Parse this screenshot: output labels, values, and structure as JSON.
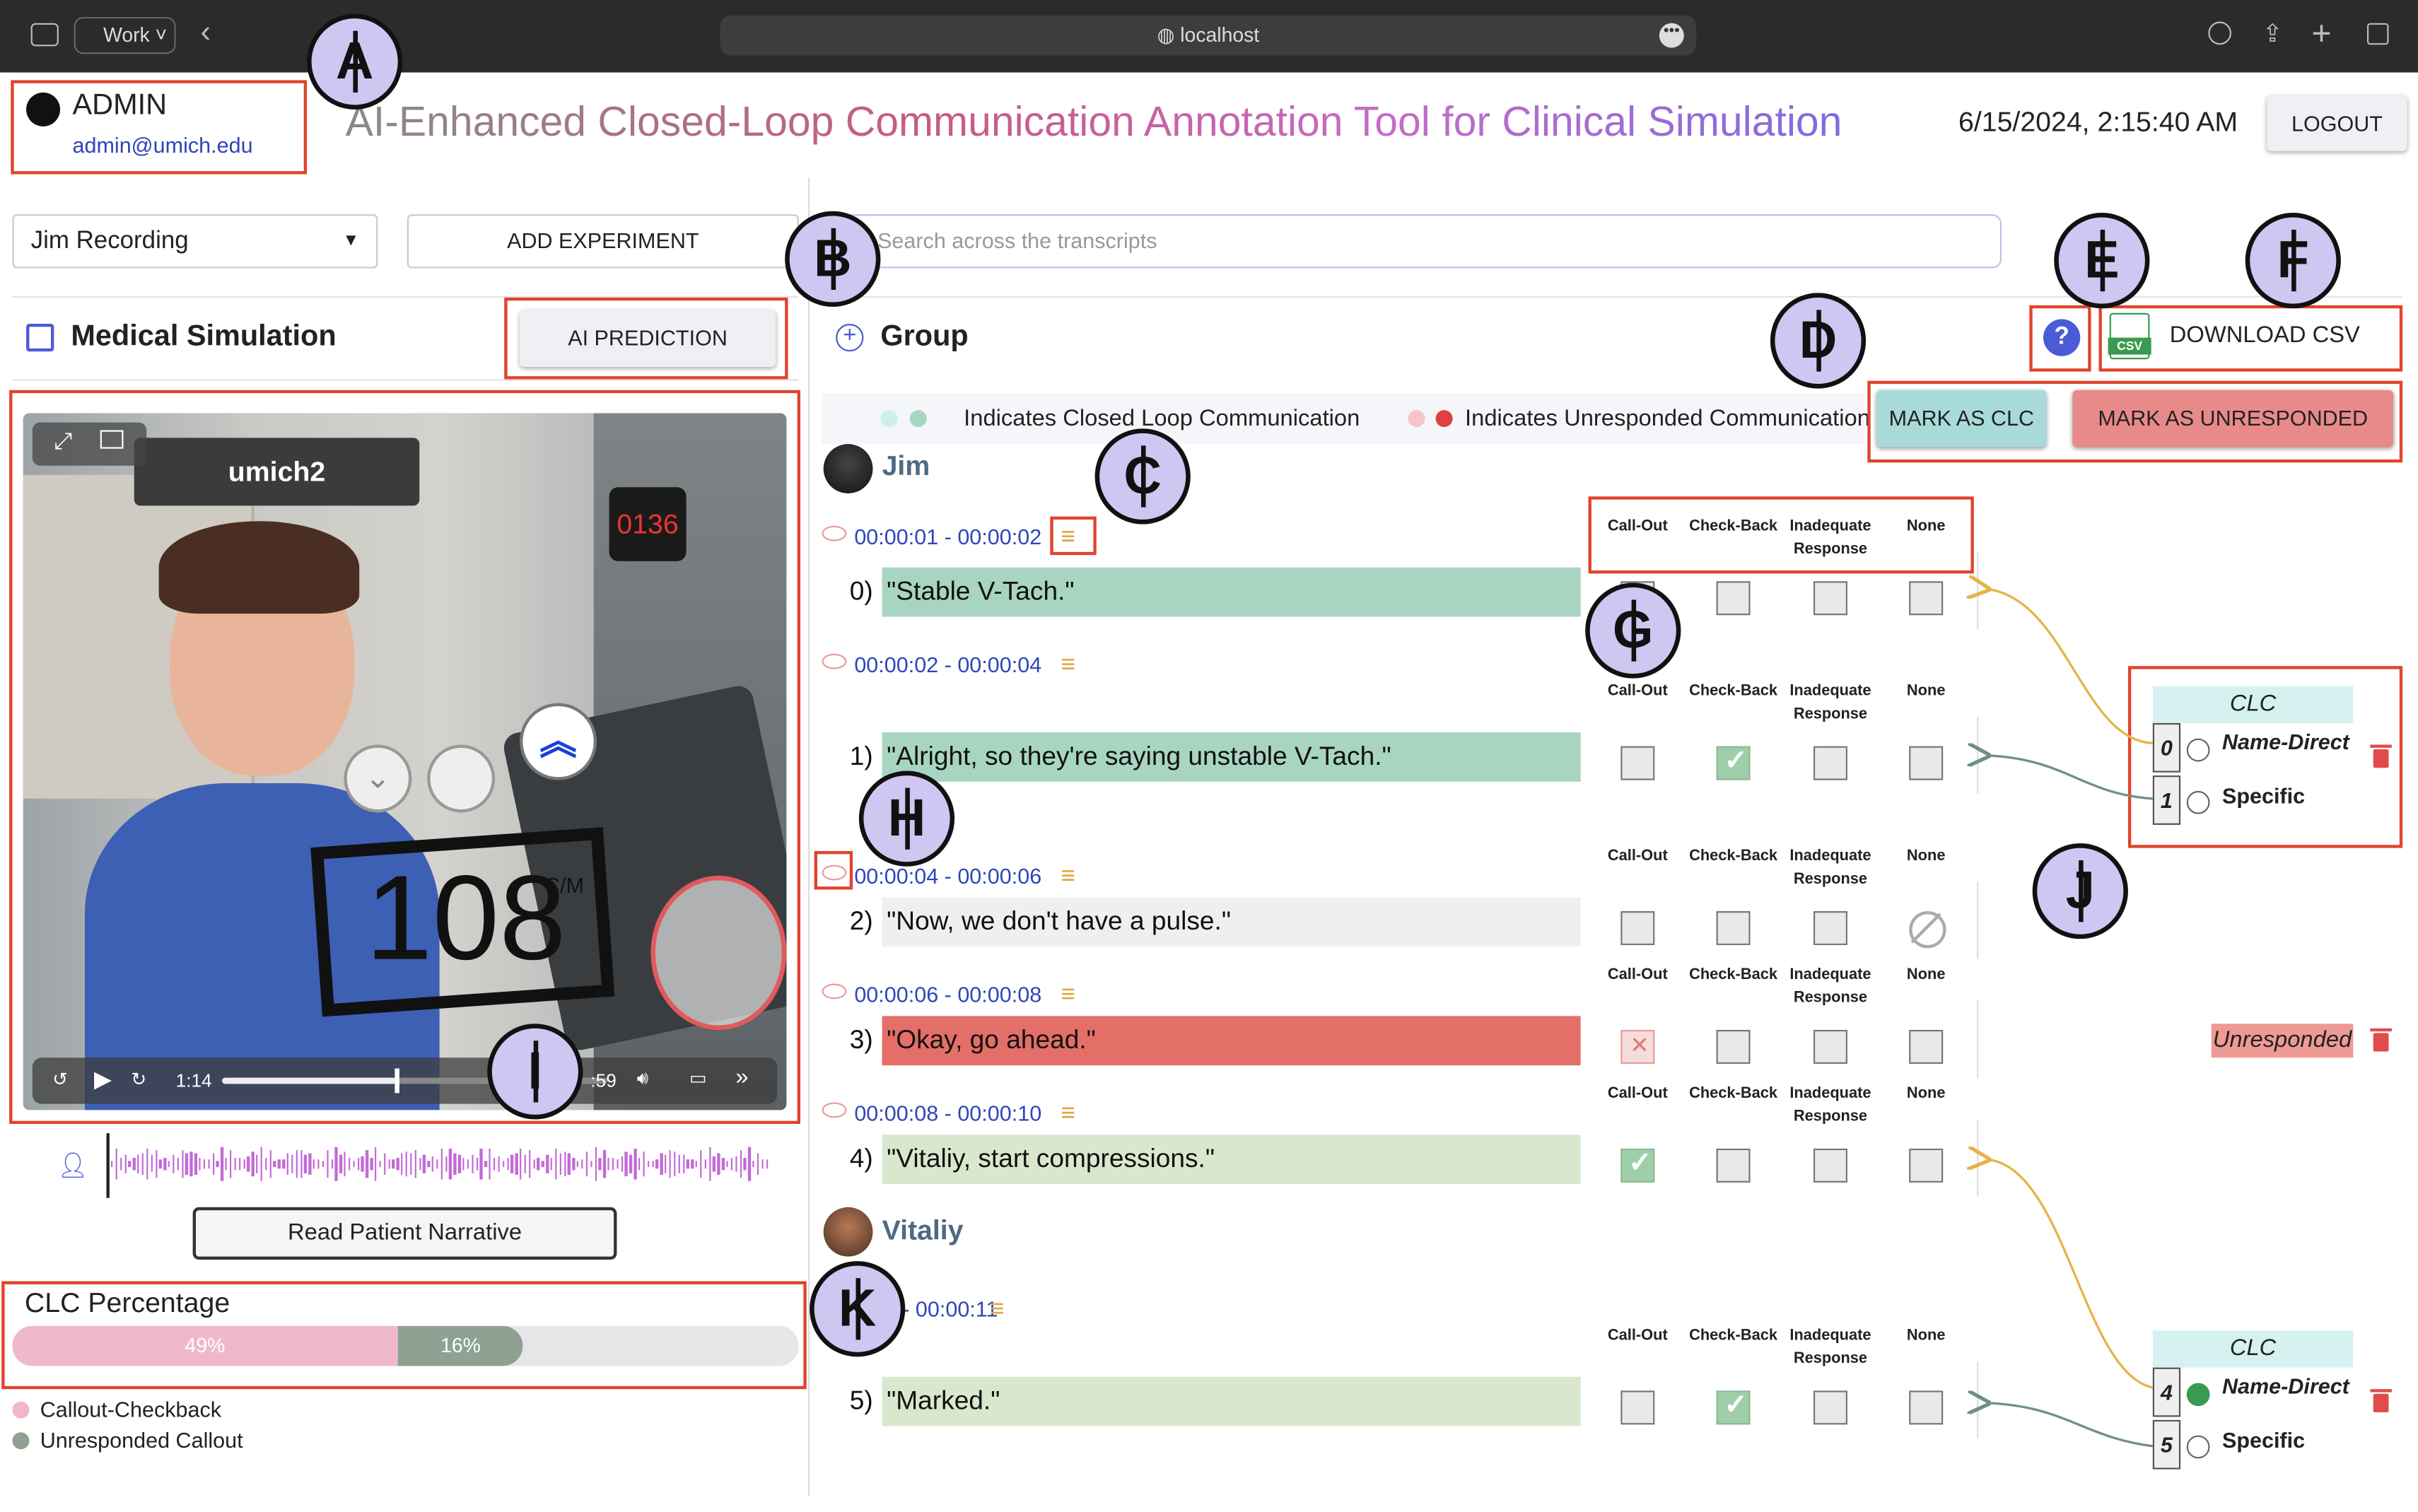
{
  "browser": {
    "workspace": "Work",
    "address": "localhost"
  },
  "user": {
    "name": "ADMIN",
    "email": "admin@umich.edu"
  },
  "app_title": "AI-Enhanced Closed-Loop Communication Annotation Tool for Clinical Simulation",
  "datetime": "6/15/2024, 2:15:40 AM",
  "logout": "LOGOUT",
  "recording_select": "Jim Recording",
  "add_experiment": "ADD EXPERIMENT",
  "search_placeholder": "Search across the transcripts",
  "section_title": "Medical Simulation",
  "ai_prediction": "AI PREDICTION",
  "video": {
    "label": "umich2",
    "monitor": "0136",
    "big_number": "108",
    "cm": "C/M",
    "time_current": "1:14",
    "time_end": ":59",
    "progress": 0.45
  },
  "read_narrative": "Read Patient Narrative",
  "clc_pct": {
    "title": "CLC Percentage",
    "a": "49%",
    "b": "16%",
    "a_val": 0.49,
    "b_val": 0.16
  },
  "legend_left": [
    {
      "label": "Callout-Checkback",
      "color": "#f2b6c8"
    },
    {
      "label": "Unresponded Callout",
      "color": "#8ea193"
    }
  ],
  "group": "Group",
  "download_csv": "DOWNLOAD CSV",
  "csv_icon": "CSV",
  "legend_clc": "Indicates Closed Loop Communication",
  "legend_unresp": "Indicates Unresponded Communication",
  "mark_clc": "MARK AS CLC",
  "mark_unresp": "MARK AS UNRESPONDED",
  "speakers": {
    "jim": "Jim",
    "vitaliy": "Vitaliy"
  },
  "col_headers": {
    "callout": "Call-Out",
    "checkback": "Check-Back",
    "inadequate": "Inadequate Response",
    "none": "None"
  },
  "utterances": [
    {
      "ts": "00:00:01 - 00:00:02",
      "idx": "0)",
      "text": "\"Stable V-Tach.\"",
      "color": "#a8d5c2"
    },
    {
      "ts": "00:00:02 - 00:00:04",
      "idx": "1)",
      "text": "\"Alright, so they're saying unstable V-Tach.\"",
      "color": "#a8d5c2"
    },
    {
      "ts": "00:00:04 - 00:00:06",
      "idx": "2)",
      "text": "\"Now, we don't have a pulse.\"",
      "color": "#efefef"
    },
    {
      "ts": "00:00:06 - 00:00:08",
      "idx": "3)",
      "text": "\"Okay, go ahead.\"",
      "color": "#e46f68"
    },
    {
      "ts": "00:00:08 - 00:00:10",
      "idx": "4)",
      "text": "\"Vitaliy, start compressions.\"",
      "color": "#d9e8cd"
    },
    {
      "ts": "0:10 - 00:00:11",
      "idx": "5)",
      "text": "\"Marked.\"",
      "color": "#d9e8cd"
    }
  ],
  "clc_groups": [
    {
      "title": "CLC",
      "rows": [
        {
          "num": "0",
          "label": "Name-Direct"
        },
        {
          "num": "1",
          "label": "Specific"
        }
      ]
    },
    {
      "title": "CLC",
      "rows": [
        {
          "num": "4",
          "label": "Name-Direct"
        },
        {
          "num": "5",
          "label": "Specific"
        }
      ]
    }
  ],
  "unresponded_tag": "Unresponded",
  "callouts": [
    "A",
    "B",
    "C",
    "D",
    "E",
    "F",
    "G",
    "H",
    "I",
    "J",
    "K"
  ],
  "help_icon": "?",
  "colors": {
    "accent": "#4b5bd6",
    "red": "#e0442e",
    "clc": "#a8d5c2",
    "unresp": "#e46f68",
    "bar_a": "#efb9cb",
    "bar_b": "#8ea193"
  }
}
